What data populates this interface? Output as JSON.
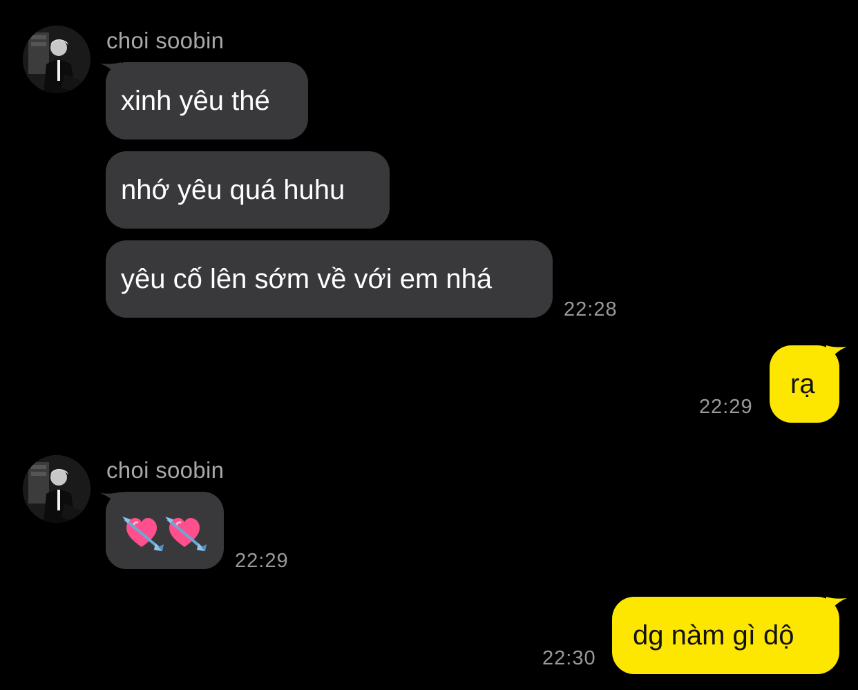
{
  "chat": {
    "groups": [
      {
        "sender": "choi soobin",
        "messages": [
          "xinh yêu thé",
          "nhớ yêu quá huhu",
          "yêu cố lên sớm về với em nhá"
        ],
        "time": "22:28"
      },
      {
        "outgoing": true,
        "messages": [
          "rạ"
        ],
        "time": "22:29"
      },
      {
        "sender": "choi soobin",
        "messages": [
          "💘 💘"
        ],
        "time": "22:29"
      },
      {
        "outgoing": true,
        "messages": [
          "dg nàm gì dộ"
        ],
        "time": "22:30"
      }
    ]
  },
  "colors": {
    "background": "#000000",
    "incoming_bubble": "#39393b",
    "outgoing_bubble": "#fde600",
    "timestamp": "#9a9a9a",
    "sender_name": "#a8a8a8"
  },
  "icons": {
    "avatar": "profile-photo",
    "emoji": "heart-with-arrow"
  }
}
